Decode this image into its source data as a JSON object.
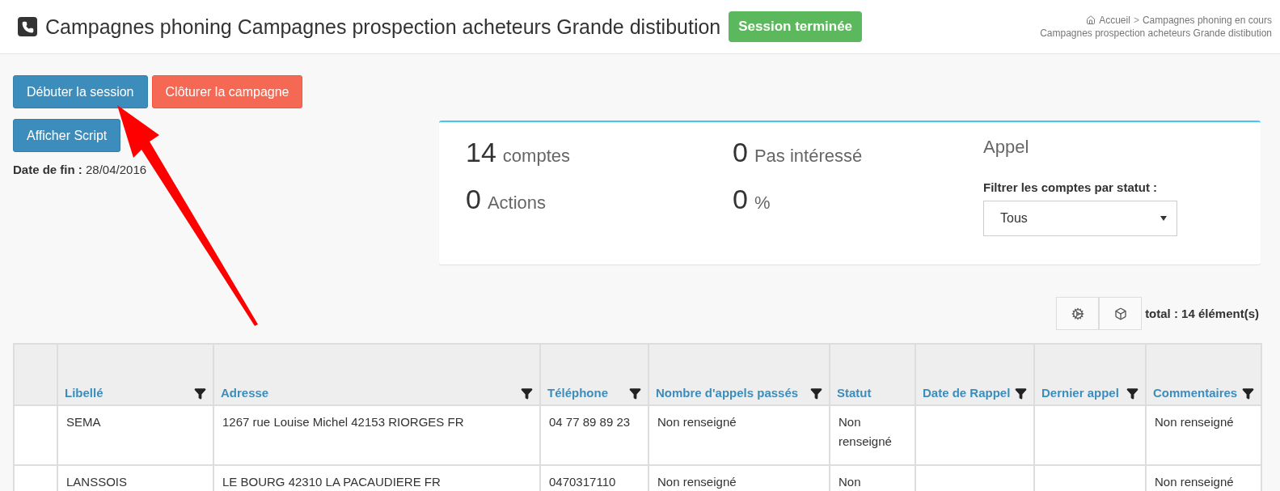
{
  "header": {
    "title": "Campagnes phoning Campagnes prospection acheteurs Grande distibution",
    "status_badge": "Session terminée",
    "breadcrumb_separator": ">",
    "breadcrumb": [
      "Accueil",
      "Campagnes phoning en cours",
      "Campagnes prospection acheteurs Grande distibution"
    ]
  },
  "actions": [
    {
      "label": "Débuter la session",
      "kind": "primary"
    },
    {
      "label": "Clôturer la campagne",
      "kind": "danger"
    }
  ],
  "script_button": {
    "label": "Afficher Script",
    "kind": "primary"
  },
  "end_date": {
    "label": "Date de fin :",
    "value": "28/04/2016"
  },
  "stats": [
    {
      "value": "14",
      "label": "comptes"
    },
    {
      "value": "0",
      "label": "Pas intéressé"
    },
    {
      "label": "Appel"
    },
    {
      "value": "0",
      "label": "Actions"
    },
    {
      "value": "0",
      "label": "%"
    }
  ],
  "status_filter": {
    "label": "Filtrer les comptes par statut :",
    "value": "Tous"
  },
  "total": "total : 14 élément(s)",
  "table": {
    "columns": [
      {
        "filter": false
      },
      {
        "label": "Libellé",
        "filter": true
      },
      {
        "label": "Adresse",
        "filter": true
      },
      {
        "label": "Téléphone",
        "filter": true
      },
      {
        "label": "Nombre d'appels passés",
        "filter": true
      },
      {
        "label": "Statut",
        "filter": false
      },
      {
        "label": "Date de Rappel",
        "filter": true
      },
      {
        "label": "Dernier appel",
        "filter": true
      },
      {
        "label": "Commentaires",
        "filter": true
      }
    ],
    "rows": [
      [
        "",
        "SEMA",
        "1267 rue Louise Michel 42153 RIORGES FR",
        "04 77 89 89 23",
        "Non renseigné",
        "Non renseigné",
        "",
        "",
        "Non renseigné"
      ],
      [
        "",
        "LANSSOIS",
        "LE BOURG 42310 LA PACAUDIERE FR",
        "0470317110",
        "Non renseigné",
        "Non",
        "",
        "",
        "Non renseigné"
      ]
    ]
  }
}
